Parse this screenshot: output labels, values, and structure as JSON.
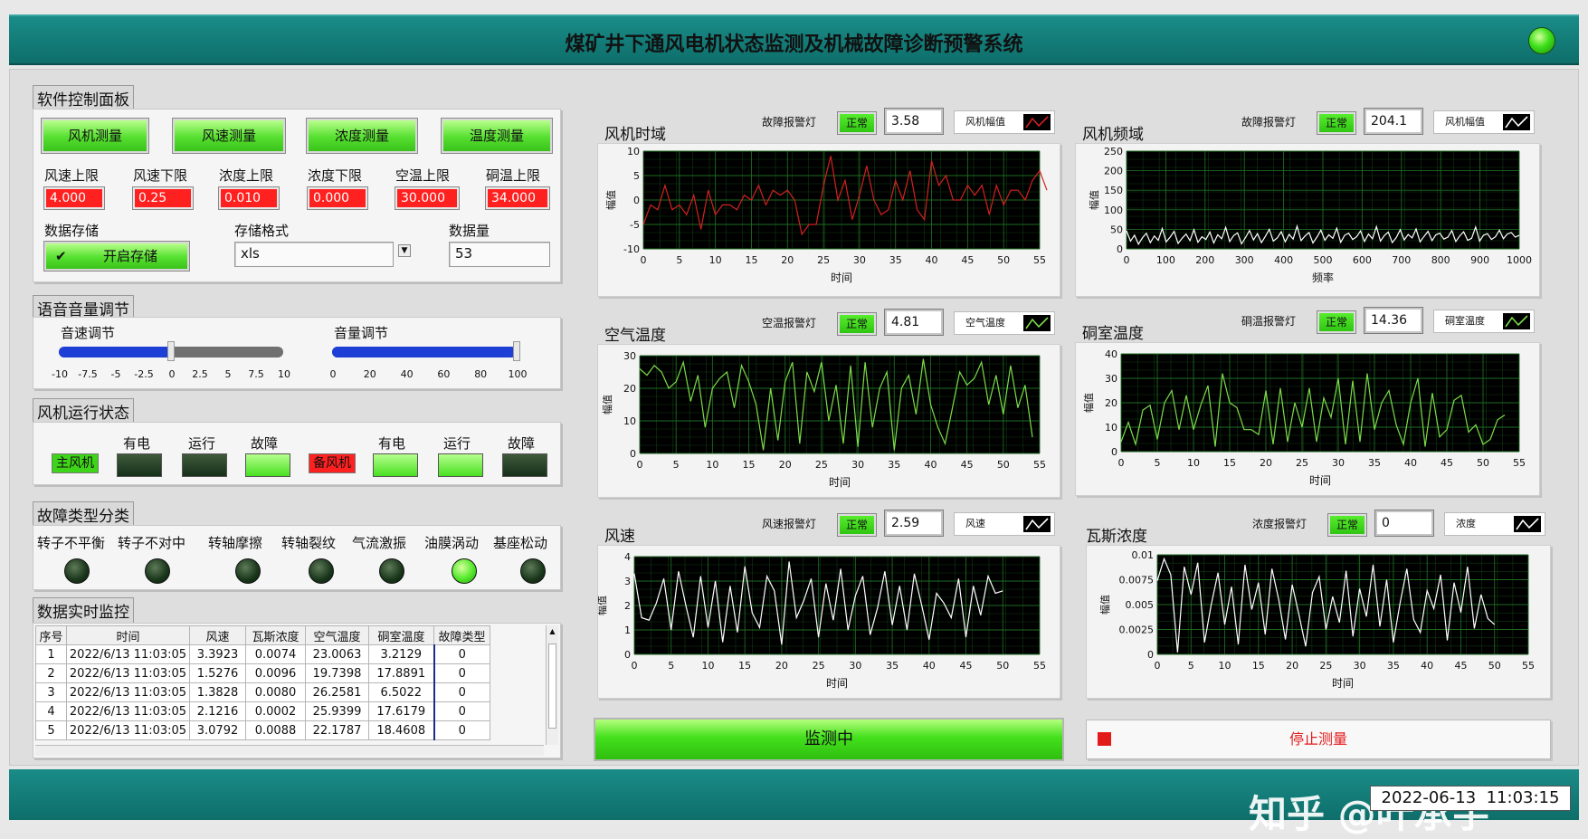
{
  "title": "煤矿井下通风电机状态监测及机械故障诊断预警系统",
  "control_panel": {
    "title": "软件控制面板",
    "buttons": [
      "风机测量",
      "风速测量",
      "浓度测量",
      "温度测量"
    ],
    "limits": [
      {
        "label": "风速上限",
        "value": "4.000"
      },
      {
        "label": "风速下限",
        "value": "0.25"
      },
      {
        "label": "浓度上限",
        "value": "0.010"
      },
      {
        "label": "浓度下限",
        "value": "0.000"
      },
      {
        "label": "空温上限",
        "value": "30.000"
      },
      {
        "label": "硐温上限",
        "value": "34.000"
      }
    ],
    "storage_label": "数据存储",
    "storage_button": "开启存储",
    "format_label": "存储格式",
    "format_value": "xls",
    "count_label": "数据量",
    "count_value": "53"
  },
  "voice_panel": {
    "title": "语音音量调节",
    "speed_label": "音速调节",
    "speed_value": 0,
    "speed_ticks": [
      "-10",
      "-7.5",
      "-5",
      "-2.5",
      "0",
      "2.5",
      "5",
      "7.5",
      "10"
    ],
    "volume_label": "音量调节",
    "volume_value": 100,
    "volume_ticks": [
      "0",
      "20",
      "40",
      "60",
      "80",
      "100"
    ]
  },
  "fan_status": {
    "title": "风机运行状态",
    "main_fan": "主风机",
    "backup_fan": "备风机",
    "status_labels": [
      "有电",
      "运行",
      "故障"
    ],
    "main_states": [
      false,
      false,
      true
    ],
    "backup_states": [
      true,
      true,
      false
    ]
  },
  "fault_types": {
    "title": "故障类型分类",
    "items": [
      {
        "label": "转子不平衡",
        "on": false
      },
      {
        "label": "转子不对中",
        "on": false
      },
      {
        "label": "转轴摩擦",
        "on": false
      },
      {
        "label": "转轴裂纹",
        "on": false
      },
      {
        "label": "气流激振",
        "on": false
      },
      {
        "label": "油膜涡动",
        "on": true
      },
      {
        "label": "基座松动",
        "on": false
      }
    ]
  },
  "monitor": {
    "title": "数据实时监控",
    "headers": [
      "序号",
      "时间",
      "风速",
      "瓦斯浓度",
      "空气温度",
      "硐室温度",
      "故障类型"
    ],
    "rows": [
      [
        "1",
        "2022/6/13 11:03:05",
        "3.3923",
        "0.0074",
        "23.0063",
        "3.2129",
        "0"
      ],
      [
        "2",
        "2022/6/13 11:03:05",
        "1.5276",
        "0.0096",
        "19.7398",
        "17.8891",
        "0"
      ],
      [
        "3",
        "2022/6/13 11:03:05",
        "1.3828",
        "0.0080",
        "26.2581",
        "6.5022",
        "0"
      ],
      [
        "4",
        "2022/6/13 11:03:05",
        "2.1216",
        "0.0002",
        "25.9399",
        "17.6179",
        "0"
      ],
      [
        "5",
        "2022/6/13 11:03:05",
        "3.0792",
        "0.0088",
        "22.1787",
        "18.4608",
        "0"
      ]
    ]
  },
  "charts_meta": [
    {
      "title": "风机时域",
      "alarm_label": "故障报警灯",
      "status": "正常",
      "value": "3.58",
      "legend": "风机幅值"
    },
    {
      "title": "风机频域",
      "alarm_label": "故障报警灯",
      "status": "正常",
      "value": "204.1",
      "legend": "风机幅值"
    },
    {
      "title": "空气温度",
      "alarm_label": "空温报警灯",
      "status": "正常",
      "value": "4.81",
      "legend": "空气温度"
    },
    {
      "title": "硐室温度",
      "alarm_label": "硐温报警灯",
      "status": "正常",
      "value": "14.36",
      "legend": "硐室温度"
    },
    {
      "title": "风速",
      "alarm_label": "风速报警灯",
      "status": "正常",
      "value": "2.59",
      "legend": "风速"
    },
    {
      "title": "瓦斯浓度",
      "alarm_label": "浓度报警灯",
      "status": "正常",
      "value": "0",
      "legend": "浓度"
    }
  ],
  "chart_data": [
    {
      "type": "line",
      "title": "",
      "xlabel": "时间",
      "ylabel": "幅值",
      "xlim": [
        0,
        55
      ],
      "ylim": [
        -10,
        10
      ],
      "xticks": [
        0,
        5,
        10,
        15,
        20,
        25,
        30,
        35,
        40,
        45,
        50,
        55
      ],
      "yticks": [
        -10,
        -5,
        0,
        5,
        10
      ],
      "series": [
        {
          "color": "#d42020",
          "values": [
            -5,
            -1,
            -2,
            3,
            -2,
            -1,
            -3,
            1,
            -6,
            2,
            -3,
            -1,
            -1,
            -2,
            1,
            0,
            3,
            -1,
            2,
            1,
            2,
            0,
            -7,
            -5,
            -5,
            3,
            9,
            0,
            4,
            -4,
            1,
            7,
            0,
            -3,
            -2,
            4,
            0,
            6,
            -2,
            -4,
            8,
            3,
            5,
            0,
            0,
            3,
            1,
            3,
            -3,
            3,
            -1,
            2,
            2,
            0,
            4,
            6,
            2
          ]
        }
      ]
    },
    {
      "type": "line",
      "title": "",
      "xlabel": "频率",
      "ylabel": "幅值",
      "xlim": [
        0,
        1000
      ],
      "ylim": [
        0,
        250
      ],
      "xticks": [
        0,
        100,
        200,
        300,
        400,
        500,
        600,
        700,
        800,
        900,
        1000
      ],
      "yticks": [
        0,
        50,
        100,
        150,
        200,
        250
      ],
      "series": [
        {
          "color": "#ffffff",
          "values": [
            46,
            20,
            35,
            12,
            28,
            40,
            16,
            33,
            22,
            52,
            18,
            30,
            45,
            14,
            27,
            38,
            21,
            49,
            17,
            31,
            24,
            43,
            15,
            36,
            26,
            55,
            19,
            34,
            41,
            13,
            29,
            47,
            23,
            39,
            16,
            32,
            50,
            20,
            28,
            44,
            18,
            37,
            25,
            58,
            21,
            33,
            42,
            15,
            30,
            48,
            22,
            36,
            27,
            53,
            17,
            35,
            40,
            24,
            31,
            46,
            19,
            38,
            26,
            57,
            20,
            34,
            43,
            16,
            29,
            49,
            23,
            37,
            28,
            51,
            18,
            32,
            45,
            21,
            36,
            40,
            25,
            30,
            47,
            19,
            33,
            44,
            22,
            27,
            56,
            20,
            35,
            39,
            24,
            31,
            48,
            26,
            38,
            42,
            30,
            35
          ]
        }
      ]
    },
    {
      "type": "line",
      "title": "",
      "xlabel": "时间",
      "ylabel": "幅值",
      "xlim": [
        0,
        55
      ],
      "ylim": [
        0,
        30
      ],
      "xticks": [
        0,
        5,
        10,
        15,
        20,
        25,
        30,
        35,
        40,
        45,
        50,
        55
      ],
      "yticks": [
        0,
        10,
        20,
        30
      ],
      "series": [
        {
          "color": "#7ddc4a",
          "values": [
            26,
            24,
            27,
            25,
            20,
            22,
            28,
            16,
            24,
            8,
            20,
            23,
            25,
            14,
            27,
            22,
            15,
            1,
            20,
            4,
            22,
            28,
            3,
            25,
            19,
            28,
            10,
            21,
            3,
            27,
            2,
            28,
            8,
            20,
            25,
            1,
            20,
            24,
            12,
            29,
            15,
            8,
            3,
            14,
            25,
            21,
            23,
            28,
            15,
            24,
            12,
            27,
            14,
            21,
            5
          ]
        }
      ]
    },
    {
      "type": "line",
      "title": "",
      "xlabel": "时间",
      "ylabel": "幅值",
      "xlim": [
        0,
        55
      ],
      "ylim": [
        0,
        40
      ],
      "xticks": [
        0,
        5,
        10,
        15,
        20,
        25,
        30,
        35,
        40,
        45,
        50,
        55
      ],
      "yticks": [
        0,
        10,
        20,
        30,
        40
      ],
      "series": [
        {
          "color": "#7ddc4a",
          "values": [
            4,
            12,
            3,
            17,
            19,
            5,
            20,
            25,
            9,
            23,
            9,
            19,
            27,
            2,
            32,
            20,
            18,
            9,
            9,
            7,
            25,
            3,
            26,
            4,
            20,
            10,
            26,
            4,
            22,
            14,
            30,
            3,
            29,
            4,
            32,
            9,
            20,
            25,
            11,
            3,
            20,
            30,
            2,
            24,
            6,
            9,
            21,
            23,
            8,
            11,
            3,
            5,
            13,
            15
          ]
        }
      ]
    },
    {
      "type": "line",
      "title": "",
      "xlabel": "时间",
      "ylabel": "幅值",
      "xlim": [
        0,
        55
      ],
      "ylim": [
        0,
        4
      ],
      "xticks": [
        0,
        5,
        10,
        15,
        20,
        25,
        30,
        35,
        40,
        45,
        50,
        55
      ],
      "yticks": [
        0,
        1,
        2,
        3,
        4
      ],
      "series": [
        {
          "color": "#ffffff",
          "values": [
            3.3,
            1.5,
            1.4,
            2.1,
            3.1,
            1.0,
            3.4,
            2.0,
            0.7,
            3.2,
            1.1,
            3.0,
            0.5,
            2.8,
            0.9,
            3.6,
            1.7,
            1.1,
            3.2,
            2.6,
            0.4,
            3.8,
            1.5,
            2.2,
            3.1,
            0.7,
            2.9,
            1.4,
            3.5,
            1.0,
            2.4,
            3.2,
            0.8,
            1.9,
            3.4,
            1.2,
            2.8,
            1.0,
            3.3,
            2.0,
            0.6,
            2.5,
            2.1,
            1.5,
            3.1,
            0.7,
            2.8,
            1.6,
            3.2,
            2.5,
            2.6
          ]
        }
      ]
    },
    {
      "type": "line",
      "title": "",
      "xlabel": "时间",
      "ylabel": "幅值",
      "xlim": [
        0,
        55
      ],
      "ylim": [
        0,
        0.01
      ],
      "xticks": [
        0,
        5,
        10,
        15,
        20,
        25,
        30,
        35,
        40,
        45,
        50,
        55
      ],
      "yticks": [
        0,
        0.0025,
        0.005,
        0.0075,
        0.01
      ],
      "series": [
        {
          "color": "#ffffff",
          "values": [
            0.0074,
            0.0096,
            0.008,
            0.0002,
            0.0088,
            0.006,
            0.0092,
            0.0012,
            0.005,
            0.0082,
            0.003,
            0.0068,
            0.001,
            0.009,
            0.0045,
            0.0072,
            0.002,
            0.0086,
            0.0055,
            0.0015,
            0.007,
            0.004,
            0.0008,
            0.0062,
            0.0078,
            0.0025,
            0.0058,
            0.0032,
            0.0084,
            0.0018,
            0.0066,
            0.0038,
            0.009,
            0.0028,
            0.0075,
            0.0012,
            0.0052,
            0.0086,
            0.0035,
            0.0022,
            0.0064,
            0.0046,
            0.008,
            0.0014,
            0.0072,
            0.0042,
            0.0088,
            0.0026,
            0.006,
            0.0036,
            0.003
          ]
        }
      ]
    }
  ],
  "monitoring_label": "监测中",
  "stop_label": "停止测量",
  "datetime": "2022-06-13  11:03:15",
  "watermark": "知乎 @叶承宇"
}
